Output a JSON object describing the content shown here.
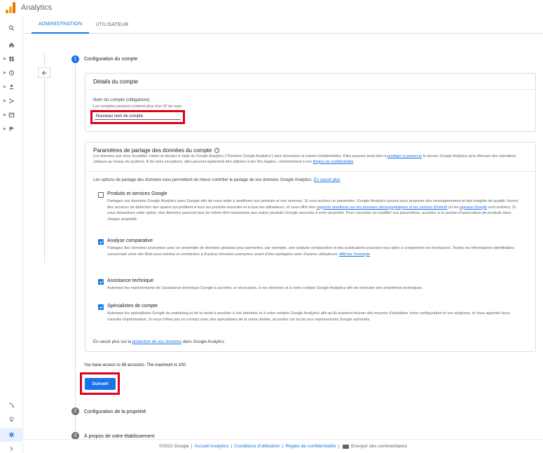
{
  "app": {
    "title": "Analytics"
  },
  "tabs": [
    {
      "label": "ADMINISTRATION"
    },
    {
      "label": "UTILISATEUR"
    }
  ],
  "steps": [
    {
      "number": "1",
      "label": "Configuration du compte"
    },
    {
      "number": "2",
      "label": "Configuration de la propriété"
    },
    {
      "number": "3",
      "label": "À propos de votre établissement"
    }
  ],
  "account_details": {
    "title": "Détails du compte",
    "field_label": "Nom du compte (obligatoire)",
    "field_hint": "Les comptes peuvent contenir plus d'un ID de suivi.",
    "field_value": "Nouveau nom de compte"
  },
  "sharing": {
    "title": "Paramètres de partage des données du compte",
    "help_icon": "?",
    "intro_1": "Les données que vous recueillez, traitez et stockez à l'aide de Google Analytics (\"Données Google Analytics\") sont sécurisées et restent confidentielles. Elles peuvent aussi bien à ",
    "intro_link_1": "protéger et préserver",
    "intro_2": " le service Google Analytics qu'à effectuer des opérations critiques au niveau du système. À de rares exceptions, elles peuvent également être utilisées à des fins légales, conformément à nos ",
    "intro_link_2": "Règles de confidentialité",
    "intro_3": ".",
    "options_intro": "Les options de partage des données vous permettent de mieux contrôler le partage de vos données Google Analytics. ",
    "options_link": "En savoir plus",
    "options": [
      {
        "title": "Produits et services Google",
        "checked": false,
        "desc_1": "Partagez vos données Google Analytics avec Google afin de nous aider à améliorer nos produits et nos services. Si vous activez ce paramètre, Google Analytics pourra vous proposer des renseignements et des insights de qualité, fournir des services de détection des spams qui profitent à tous les produits associés et à tous les utilisateurs, et vous offrir des ",
        "link_1": "rapports améliorés sur les données démographiques et les centres d'intérêt",
        "desc_2": " (si les ",
        "link_2": "signaux Google",
        "desc_3": " sont activés). Si vous désactivez cette option, des données pourront tout de même être transmises aux autres produits Google associés à votre propriété. Pour consulter ou modifier vos paramètres, accédez à la section d'association de produits dans chaque propriété."
      },
      {
        "title": "Analyse comparative",
        "checked": true,
        "desc_1": "Partagez des données anonymes avec un ensemble de données globales pour permettre, par exemple, une analyse comparative et des publications pouvant vous aider à comprendre les tendances. Toutes les informations identifiables concernant votre site Web sont retirées et combinées à d'autres données anonymes avant d'être partagées avec d'autres utilisateurs. ",
        "link_1": "Afficher l'exemple",
        "desc_2": "",
        "link_2": "",
        "desc_3": ""
      },
      {
        "title": "Assistance technique",
        "checked": true,
        "desc_1": "Autorisez les représentants de l'assistance technique Google à accéder, si nécessaire, à vos données et à votre compte Google Analytics afin de résoudre des problèmes techniques.",
        "link_1": "",
        "desc_2": "",
        "link_2": "",
        "desc_3": ""
      },
      {
        "title": "Spécialistes de compte",
        "checked": true,
        "desc_1": "Autorisez les spécialistes Google du marketing et de la vente à accéder à vos données et à votre compte Google Analytics afin qu'ils puissent trouver des moyens d'améliorer votre configuration et vos analyses, et vous apporter leurs conseils d'optimisation. Si vous n'êtes pas en contact avec des spécialistes de la vente dédiés, accordez cet accès aux représentants Google autorisés.",
        "link_1": "",
        "desc_2": "",
        "link_2": "",
        "desc_3": ""
      }
    ],
    "footer_1": "En savoir plus sur la ",
    "footer_link": "protection de vos données",
    "footer_2": " dans Google Analytics"
  },
  "accounts_note": "You have access to 98 accounts. The maximum is 100.",
  "next_button": "Suivant",
  "footer": {
    "copyright": "©2022 Google",
    "link_1": "Accueil Analytics",
    "link_2": "Conditions d'utilisation",
    "link_3": "Règles de confidentialité",
    "feedback": "Envoyer des commentaires"
  },
  "sidebar_icons": [
    "search-icon",
    "home-icon",
    "dashboard-icon",
    "clock-icon",
    "person-icon",
    "acquisition-icon",
    "behavior-icon",
    "flag-icon",
    "attribution-icon",
    "lightbulb-icon",
    "gear-icon",
    "expand-icon"
  ],
  "colors": {
    "accent": "#1a73e8",
    "highlight_red": "#e0001b",
    "step_inactive": "#757575"
  }
}
